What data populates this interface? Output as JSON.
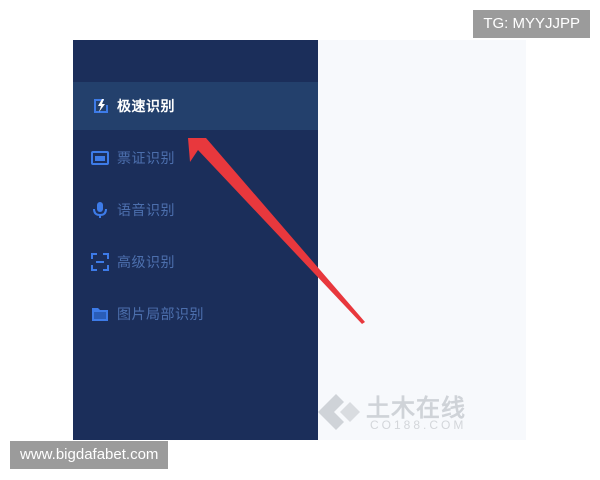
{
  "watermarks": {
    "top": "TG: MYYJJPP",
    "bottom": "www.bigdafabet.com"
  },
  "sidebar": {
    "items": [
      {
        "label": "极速识别",
        "icon": "flash-icon",
        "active": true
      },
      {
        "label": "票证识别",
        "icon": "card-icon",
        "active": false
      },
      {
        "label": "语音识别",
        "icon": "microphone-icon",
        "active": false
      },
      {
        "label": "高级识别",
        "icon": "scan-frame-icon",
        "active": false
      },
      {
        "label": "图片局部识别",
        "icon": "image-folder-icon",
        "active": false
      }
    ]
  },
  "logo_watermark": {
    "brand_cn": "土木在线",
    "brand_en": "CO188.COM"
  },
  "colors": {
    "sidebar_bg": "#1b2e5a",
    "active_bg": "#23406c",
    "inactive_text": "#4c6fad",
    "icon_blue": "#3d7be8",
    "arrow_red": "#e8383d"
  }
}
